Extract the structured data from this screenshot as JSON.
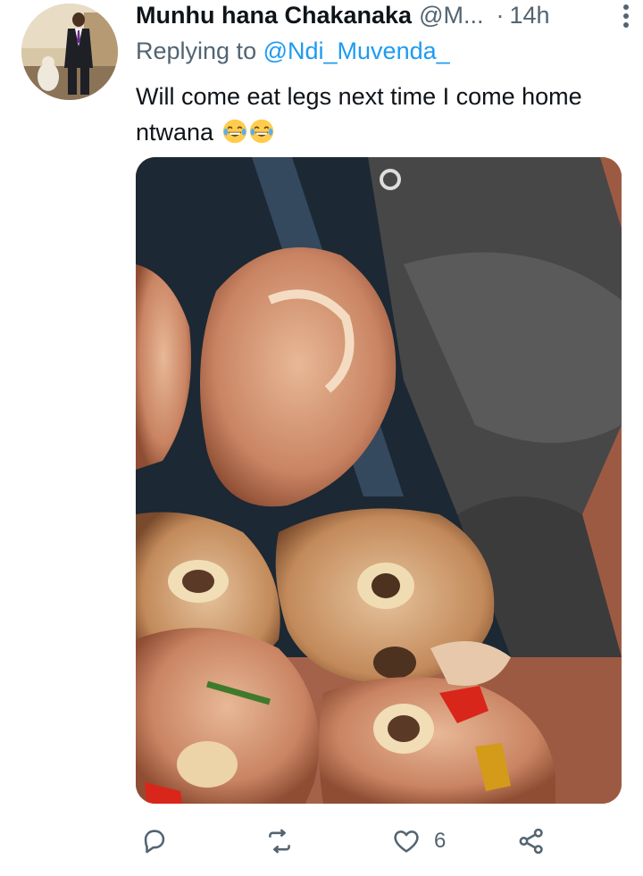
{
  "tweet": {
    "display_name": "Munhu hana Chakanaka",
    "handle": "@M...",
    "separator": "·",
    "time": "14h",
    "reply_prefix": "Replying to",
    "reply_to": "@Ndi_Muvenda_",
    "text": "Will come eat legs next time I come home ntwana",
    "emoji": [
      "tears-of-joy-emoji",
      "tears-of-joy-emoji"
    ]
  },
  "actions": {
    "reply_icon": "reply-icon",
    "retweet_icon": "retweet-icon",
    "like_icon": "heart-icon",
    "like_count": "6",
    "share_icon": "share-icon"
  },
  "colors": {
    "link": "#1d9bf0",
    "secondary": "#536471",
    "text": "#0f1419"
  }
}
